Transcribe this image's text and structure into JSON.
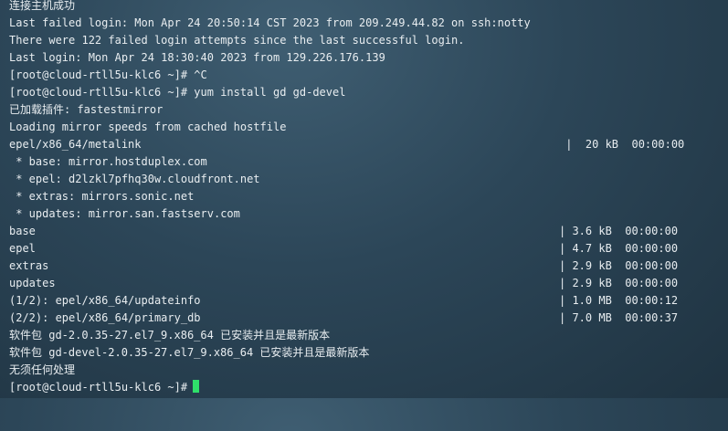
{
  "terminal": {
    "lines": [
      {
        "text": "连接主机成功"
      },
      {
        "text": "Last failed login: Mon Apr 24 20:50:14 CST 2023 from 209.249.44.82 on ssh:notty"
      },
      {
        "text": "There were 122 failed login attempts since the last successful login."
      },
      {
        "text": "Last login: Mon Apr 24 18:30:40 2023 from 129.226.176.139"
      },
      {
        "text": "[root@cloud-rtll5u-klc6 ~]# ^C"
      },
      {
        "text": "[root@cloud-rtll5u-klc6 ~]# yum install gd gd-devel"
      },
      {
        "text": "已加载插件: fastestmirror"
      },
      {
        "text": "Loading mirror speeds from cached hostfile"
      },
      {
        "text": "epel/x86_64/metalink",
        "status": " |  20 kB  00:00:00"
      },
      {
        "text": " * base: mirror.hostduplex.com"
      },
      {
        "text": " * epel: d2lzkl7pfhq30w.cloudfront.net"
      },
      {
        "text": " * extras: mirrors.sonic.net"
      },
      {
        "text": " * updates: mirror.san.fastserv.com"
      },
      {
        "text": "base",
        "status": "| 3.6 kB  00:00:00"
      },
      {
        "text": "epel",
        "status": "| 4.7 kB  00:00:00"
      },
      {
        "text": "extras",
        "status": "| 2.9 kB  00:00:00"
      },
      {
        "text": "updates",
        "status": "| 2.9 kB  00:00:00"
      },
      {
        "text": "(1/2): epel/x86_64/updateinfo",
        "status": "| 1.0 MB  00:00:12"
      },
      {
        "text": "(2/2): epel/x86_64/primary_db",
        "status": "| 7.0 MB  00:00:37"
      },
      {
        "text": "软件包 gd-2.0.35-27.el7_9.x86_64 已安装并且是最新版本"
      },
      {
        "text": "软件包 gd-devel-2.0.35-27.el7_9.x86_64 已安装并且是最新版本"
      },
      {
        "text": "无须任何处理"
      }
    ],
    "prompt": "[root@cloud-rtll5u-klc6 ~]#",
    "cursor_color": "#2fe06a"
  }
}
